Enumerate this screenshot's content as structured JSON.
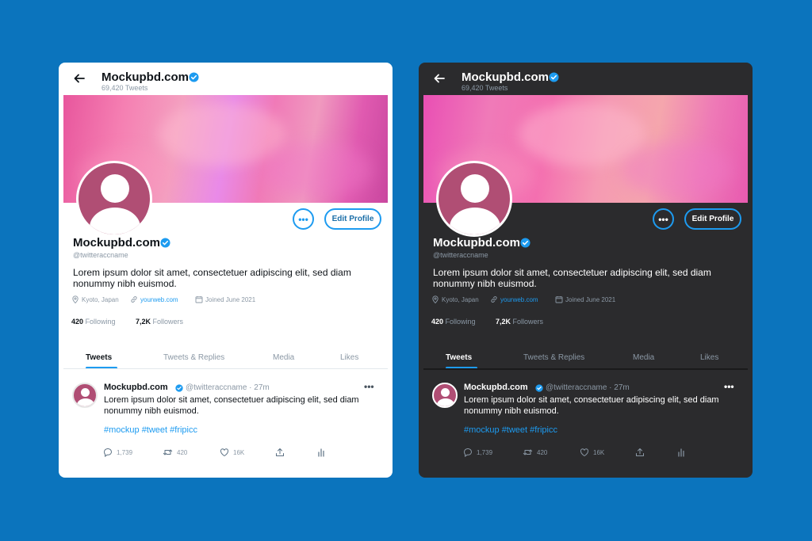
{
  "cards": {
    "light": {
      "header": {
        "name": "Mockupbd.com",
        "tweet_count": "69,420 Tweets"
      },
      "more_button": "•••",
      "edit_profile": "Edit Profile",
      "profile": {
        "name": "Mockupbd.com",
        "handle": "@twitteraccname",
        "bio": "Lorem ipsum dolor sit amet, consectetuer adipiscing elit, sed diam nonummy nibh euismod.",
        "location": "Kyoto, Japan",
        "website": "yourweb.com",
        "joined": "Joined June 2021",
        "following_count": "420",
        "following_label": "Following",
        "followers_count": "7,2K",
        "followers_label": "Followers"
      },
      "tabs": [
        "Tweets",
        "Tweets & Replies",
        "Media",
        "Likes"
      ],
      "tweet": {
        "name": "Mockupbd.com",
        "handle_time": "@twitteraccname · 27m",
        "more": "•••",
        "text": "Lorem ipsum dolor sit amet, consectetuer adipiscing elit, sed diam nonummy nibh euismod.",
        "tags": "#mockup #tweet #fripicc",
        "replies": "1,739",
        "retweets": "420",
        "likes": "16K"
      }
    },
    "dark": {
      "header": {
        "name": "Mockupbd.com",
        "tweet_count": "69,420 Tweets"
      },
      "more_button": "•••",
      "edit_profile": "Edit Profile",
      "profile": {
        "name": "Mockupbd.com",
        "handle": "@twitteraccname",
        "bio": "Lorem ipsum dolor sit amet, consectetuer adipiscing elit, sed diam nonummy nibh euismod.",
        "location": "Kyoto, Japan",
        "website": "yourweb.com",
        "joined": "Joined June 2021",
        "following_count": "420",
        "following_label": "Following",
        "followers_count": "7,2K",
        "followers_label": "Followers"
      },
      "tabs": [
        "Tweets",
        "Tweets & Replies",
        "Media",
        "Likes"
      ],
      "tweet": {
        "name": "Mockupbd.com",
        "handle_time": "@twitteraccname · 27m",
        "more": "•••",
        "text": "Lorem ipsum dolor sit amet, consectetuer adipiscing elit, sed diam nonummy nibh euismod.",
        "tags": "#mockup #tweet #fripicc",
        "replies": "1,739",
        "retweets": "420",
        "likes": "16K"
      }
    }
  },
  "colors": {
    "background": "#0b74bd",
    "accent": "#1d9bf0",
    "light_card": "#ffffff",
    "dark_card": "#2b2b2d",
    "avatar": "#b04e74"
  },
  "icons": [
    "back-arrow-icon",
    "verified-badge-icon",
    "location-pin-icon",
    "link-icon",
    "calendar-icon",
    "reply-icon",
    "retweet-icon",
    "like-icon",
    "share-icon",
    "analytics-icon"
  ]
}
